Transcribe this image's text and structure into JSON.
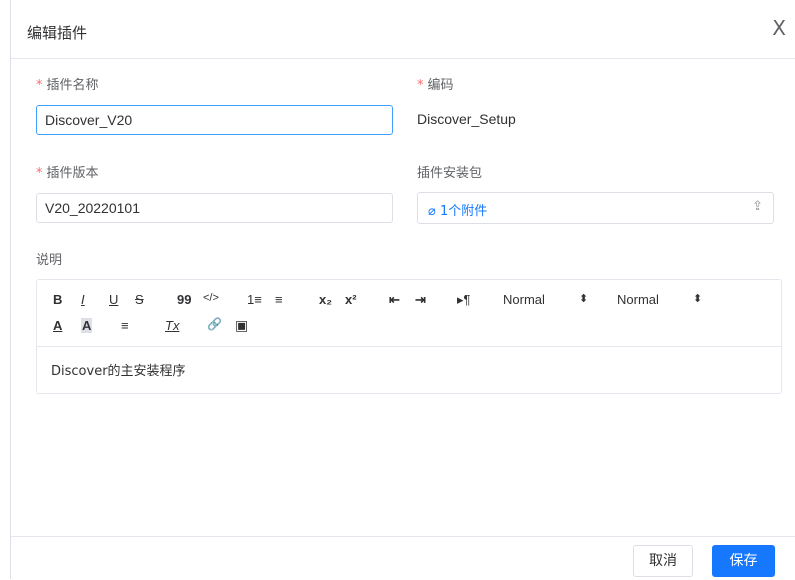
{
  "dialog": {
    "title": "编辑插件",
    "close": "X"
  },
  "form": {
    "plugin_name": {
      "label": "插件名称",
      "value": "Discover_V20",
      "required": "*"
    },
    "code": {
      "label": "编码",
      "value": "Discover_Setup",
      "required": "*"
    },
    "plugin_version": {
      "label": "插件版本",
      "value": "V20_20220101",
      "required": "*"
    },
    "package": {
      "label": "插件安装包",
      "attachment": "1个附件"
    },
    "description": {
      "label": "说明",
      "content": "Discover的主安装程序"
    }
  },
  "toolbar": {
    "bold": "B",
    "italic": "I",
    "underline": "U",
    "strike": "S",
    "blockquote": "99",
    "code": "</>",
    "ordered": "1≡",
    "bullet": "≡",
    "sub": "x₂",
    "sup": "x²",
    "outdent": "⇤",
    "indent": "⇥",
    "rtl": "▸¶",
    "select1": "Normal",
    "select2": "Normal",
    "color": "A",
    "background": "A",
    "align": "≡",
    "clean": "Tx",
    "link": "🔗",
    "image": "▣"
  },
  "footer": {
    "cancel": "取消",
    "save": "保存"
  },
  "colors": {
    "accent": "#1677ff",
    "required": "#f56c6c"
  }
}
